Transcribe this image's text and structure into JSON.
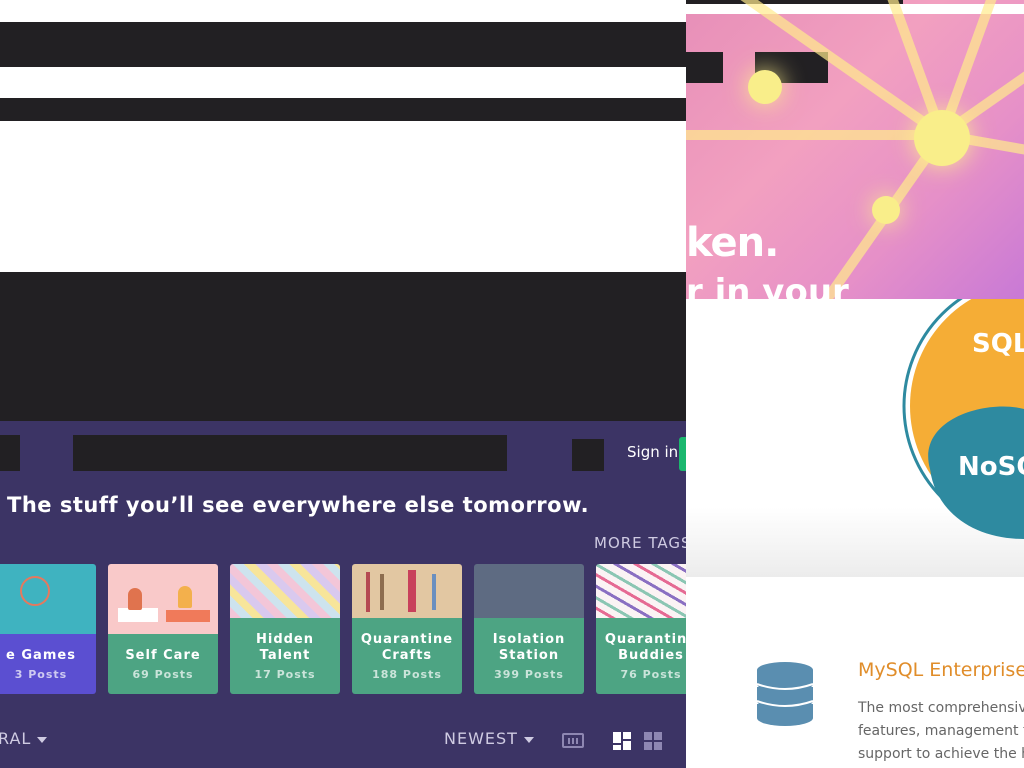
{
  "ad_top": {
    "brand_text": "ken.",
    "tagline_text": "r in your",
    "colors": {
      "sun": "#f9ee8a",
      "bg": "#e78fb8"
    }
  },
  "ad_db": {
    "circle_labels": [
      "SQL",
      "NoSQ"
    ],
    "colors": {
      "ring": "#2e8aa0",
      "top": "#f5ad36",
      "bottom": "#2e8aa0"
    }
  },
  "mysql": {
    "icon": "database-icon",
    "title": "MySQL Enterprise",
    "description": "The most comprehensive\nfeatures, management to\nsupport to achieve the hi"
  },
  "imgur": {
    "sign_in": "Sign in",
    "tagline": "The stuff you’ll see everywhere else tomorrow.",
    "more_tags": "MORE TAGS",
    "tags": [
      {
        "name": "e Games",
        "count": "3 Posts",
        "color": "#5b4fd1"
      },
      {
        "name": "Self Care",
        "count": "69 Posts",
        "color": "#4da483"
      },
      {
        "name": "Hidden Talent",
        "count": "17 Posts",
        "color": "#4da483"
      },
      {
        "name": "Quarantine Crafts",
        "count": "188 Posts",
        "color": "#4da483"
      },
      {
        "name": "Isolation Station",
        "count": "399 Posts",
        "color": "#4da483"
      },
      {
        "name": "Quarantine Buddies",
        "count": "76 Posts",
        "color": "#4da483"
      }
    ],
    "sort_section": "RAL",
    "sort_order": "NEWEST",
    "panel_color": "#3c3465"
  }
}
